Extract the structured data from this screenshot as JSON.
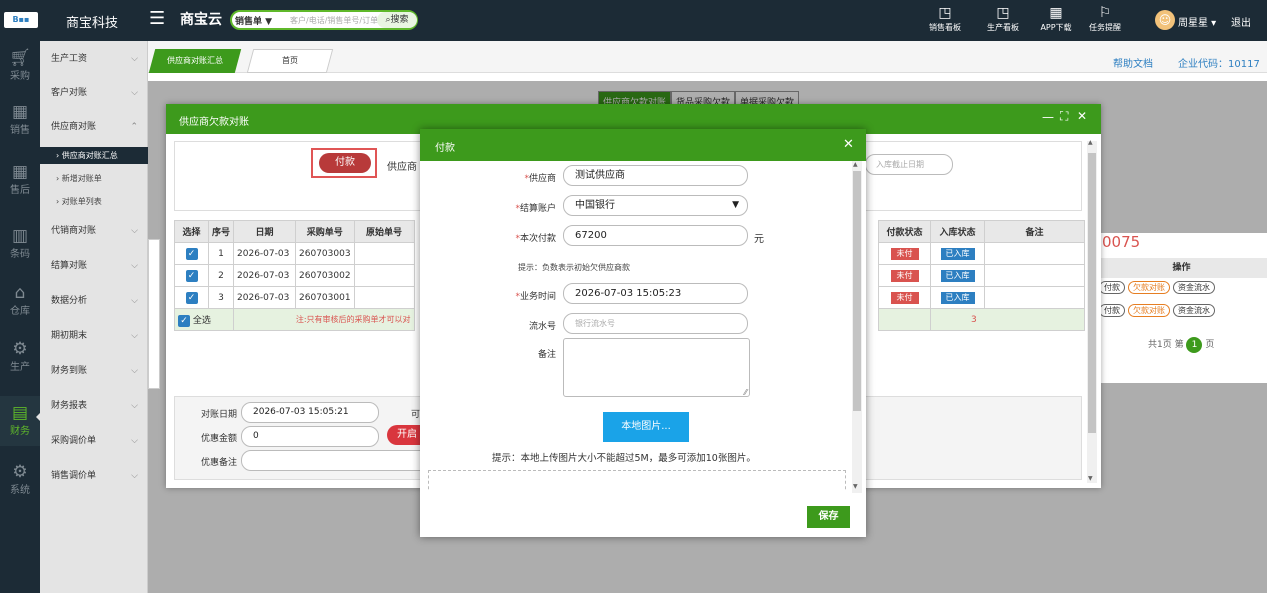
{
  "topbar": {
    "brand": "商宝科技",
    "app_name": "商宝云",
    "search_type": "销售单 ▼",
    "search_placeholder": "客户/电话/销售单号/订单号",
    "search_button": "搜索",
    "icons": [
      {
        "label": "销售看板",
        "icon": "chart-icon"
      },
      {
        "label": "生产看板",
        "icon": "chart-icon"
      },
      {
        "label": "APP下载",
        "icon": "qrcode-icon"
      },
      {
        "label": "任务提醒",
        "icon": "flag-icon"
      }
    ],
    "user": "周星星 ▾",
    "logout": "退出"
  },
  "leftnav": [
    {
      "label": "采购",
      "icon": "cart-icon"
    },
    {
      "label": "销售",
      "icon": "grid-icon"
    },
    {
      "label": "售后",
      "icon": "grid-icon"
    },
    {
      "label": "条码",
      "icon": "barcode-icon"
    },
    {
      "label": "仓库",
      "icon": "warehouse-icon"
    },
    {
      "label": "生产",
      "icon": "robot-arm-icon"
    },
    {
      "label": "财务",
      "icon": "calculator-icon"
    },
    {
      "label": "系统",
      "icon": "gear-icon"
    }
  ],
  "sidemenu": {
    "items": [
      "生产工资",
      "客户对账",
      "供应商对账"
    ],
    "subitems": [
      "› 供应商对账汇总",
      "› 新增对账单",
      "› 对账单列表"
    ],
    "items2": [
      "代销商对账",
      "结算对账",
      "数据分析",
      "期初期末",
      "财务到账",
      "财务报表",
      "采购调价单",
      "销售调价单"
    ]
  },
  "tabs": [
    "供应商对账汇总",
    "首页"
  ],
  "header_links": {
    "help": "帮助文档",
    "company": "企业代码：10117"
  },
  "behind": {
    "subtabs": [
      "供应商欠款对账",
      "货品采购欠款",
      "单据采购欠款"
    ],
    "amount_fragment": "0075",
    "op_header": "操作",
    "ops": [
      "付款",
      "欠款对账",
      "资金流水"
    ],
    "pager_text": "共1页 第",
    "pager_current": "1",
    "pager_suffix": "页"
  },
  "dialog_outer": {
    "title": "供应商欠款对账",
    "pay_button": "付款",
    "supplier_label": "供应商",
    "date_end_placeholder": "入库截止日期",
    "columns": [
      "选择",
      "序号",
      "日期",
      "采购单号",
      "原始单号"
    ],
    "columns_right": [
      "付款状态",
      "入库状态",
      "备注"
    ],
    "rows": [
      {
        "seq": "1",
        "date": "2026-07-03",
        "no": "260703003",
        "pay": "未付",
        "stock": "已入库"
      },
      {
        "seq": "2",
        "date": "2026-07-03",
        "no": "260703002",
        "pay": "未付",
        "stock": "已入库"
      },
      {
        "seq": "3",
        "date": "2026-07-03",
        "no": "260703001",
        "pay": "未付",
        "stock": "已入库"
      }
    ],
    "select_all": "全选",
    "note": "注:只有审核后的采购单才可以对",
    "total_count": "3",
    "recon_date_label": "对账日期",
    "recon_date": "2026-07-03 15:05:21",
    "discount_label": "优惠金额",
    "discount": "0",
    "discount_note_label": "优惠备注",
    "open_button_fragment": "开启",
    "cut_fragment": "可"
  },
  "dialog_pay": {
    "title": "付款",
    "supplier_label": "供应商",
    "supplier": "测试供应商",
    "account_label": "结算账户",
    "account": "中国银行",
    "amount_label": "本次付款",
    "amount": "67200",
    "unit": "元",
    "hint_negative": "提示：负数表示初始欠供应商款",
    "time_label": "业务时间",
    "time": "2026-07-03 15:05:23",
    "serial_label": "流水号",
    "serial_placeholder": "银行流水号",
    "remark_label": "备注",
    "upload_button": "本地图片...",
    "upload_hint": "提示：本地上传图片大小不能超过5M，最多可添加10张图片。",
    "save_button": "保存"
  },
  "colors": {
    "brand_green": "#3d9a1c",
    "accent_red": "#d9534f",
    "blue": "#2d7fc1",
    "dark": "#1c2b36"
  }
}
